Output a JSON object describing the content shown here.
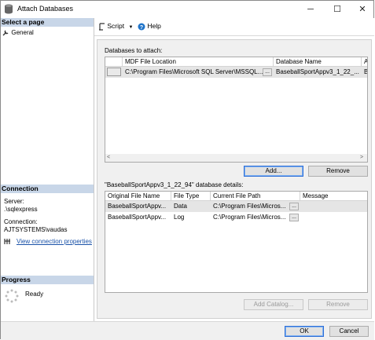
{
  "window": {
    "title": "Attach Databases",
    "minimize": "─",
    "maximize": "☐",
    "close": "✕"
  },
  "left": {
    "select_page_header": "Select a page",
    "pages": [
      "General"
    ],
    "connection_header": "Connection",
    "server_label": "Server:",
    "server_value": ".\\sqlexpress",
    "connection_label": "Connection:",
    "connection_value": "AJTSYSTEMS\\vaudas",
    "view_conn_props": "View connection properties",
    "progress_header": "Progress",
    "progress_status": "Ready"
  },
  "toolbar": {
    "script_label": "Script",
    "help_label": "Help"
  },
  "attach": {
    "label": "Databases to attach:",
    "columns": [
      "",
      "MDF File Location",
      "Database Name",
      "Att"
    ],
    "rows": [
      {
        "mdf": "C:\\Program Files\\Microsoft SQL Server\\MSSQL...",
        "db_name": "BaseballSportAppv3_1_22_...",
        "attach_as": "Ba"
      }
    ],
    "add_button": "Add...",
    "remove_button": "Remove"
  },
  "details": {
    "label": "\"BaseballSportAppv3_1_22_94\" database details:",
    "columns": [
      "Original File Name",
      "File Type",
      "Current File Path",
      "Message"
    ],
    "rows": [
      {
        "orig": "BaseballSportAppv...",
        "type": "Data",
        "path": "C:\\Program Files\\Micros...",
        "message": ""
      },
      {
        "orig": "BaseballSportAppv...",
        "type": "Log",
        "path": "C:\\Program Files\\Micros...",
        "message": ""
      }
    ],
    "add_catalog_button": "Add Catalog...",
    "remove_button": "Remove"
  },
  "footer": {
    "ok": "OK",
    "cancel": "Cancel"
  },
  "colors": {
    "section_header_bg": "#c8d6e8",
    "link": "#1a52a8",
    "selected_row": "#e5e5e5",
    "primary_border": "#2f6fd6"
  }
}
